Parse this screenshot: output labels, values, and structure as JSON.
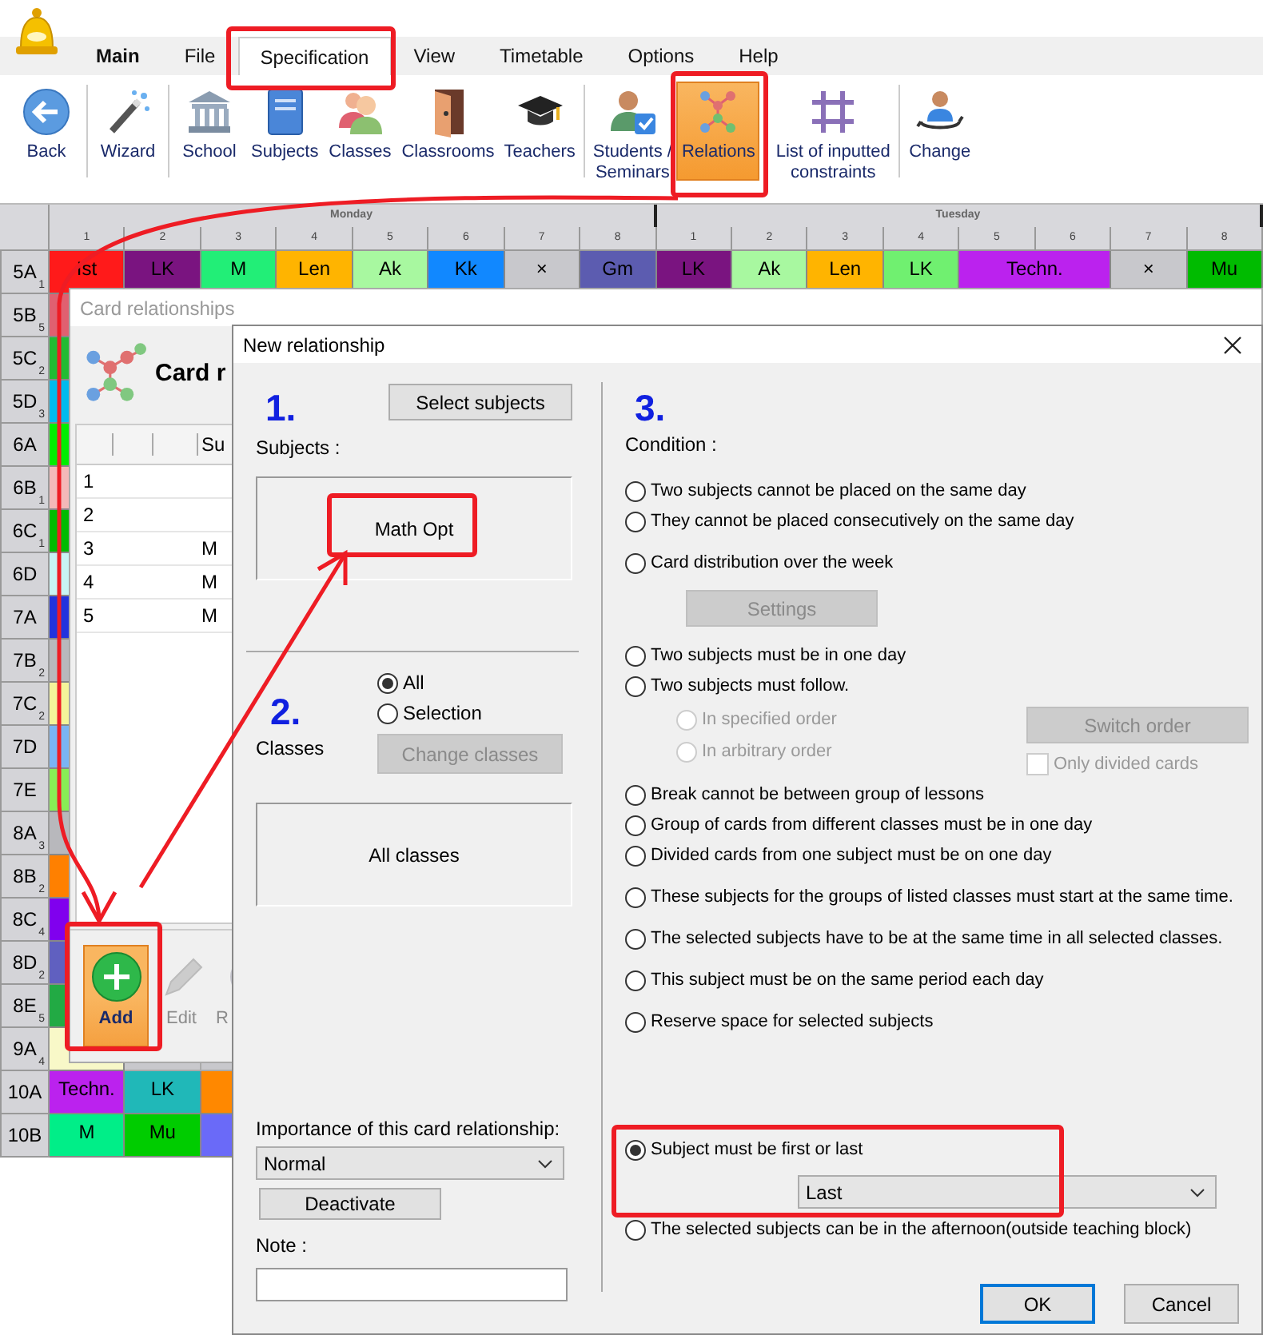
{
  "menu": [
    {
      "label": "Main",
      "kind": "app",
      "selected": false
    },
    {
      "label": "File",
      "kind": "tab",
      "selected": false
    },
    {
      "label": "Specification",
      "kind": "tab",
      "selected": true
    },
    {
      "label": "View",
      "kind": "tab",
      "selected": false
    },
    {
      "label": "Timetable",
      "kind": "tab",
      "selected": false
    },
    {
      "label": "Options",
      "kind": "tab",
      "selected": false
    },
    {
      "label": "Help",
      "kind": "tab",
      "selected": false
    }
  ],
  "toolbar": {
    "groups": [
      [
        {
          "label": "Back",
          "selected": false
        }
      ],
      [
        {
          "label": "Wizard",
          "selected": false
        }
      ],
      [
        {
          "label": "School",
          "selected": false
        },
        {
          "label": "Subjects",
          "selected": false
        },
        {
          "label": "Classes",
          "selected": false
        },
        {
          "label": "Classrooms",
          "selected": false
        },
        {
          "label": "Teachers",
          "selected": false
        }
      ],
      [
        {
          "label": "Students /\nSeminars",
          "selected": false
        },
        {
          "label": "Relations",
          "selected": true
        },
        {
          "label": "List of inputted\nconstraints",
          "selected": false
        }
      ],
      [
        {
          "label": "Change",
          "selected": false
        }
      ]
    ]
  },
  "timetable": {
    "days": [
      {
        "name": "Monday",
        "periods": [
          "1",
          "2",
          "3",
          "4",
          "5",
          "6",
          "7",
          "8"
        ]
      },
      {
        "name": "Tuesday",
        "periods": [
          "1",
          "2",
          "3",
          "4",
          "5",
          "6",
          "7",
          "8"
        ]
      }
    ],
    "rows": [
      {
        "class": "5A",
        "count": "1",
        "cells": [
          {
            "text": "Ist",
            "color": "#ff1a1a",
            "kind": "single"
          },
          {
            "text": "LK",
            "color": "#7a1480",
            "kind": "single"
          },
          {
            "text": "M",
            "color": "#22ee77",
            "kind": "single"
          },
          {
            "text": "Len",
            "color": "#ffb400",
            "kind": "single"
          },
          {
            "text": "Ak",
            "color": "#a8f8a0",
            "kind": "single"
          },
          {
            "text": "Kk",
            "color": "#1188ff",
            "kind": "single"
          },
          {
            "text": "×",
            "color": "#c8c8cc",
            "kind": "single"
          },
          {
            "text": "Gm",
            "color": "#5c5cb0",
            "kind": "single"
          },
          {
            "text": "LK",
            "color": "#7a1480",
            "kind": "single"
          },
          {
            "text": "Ak",
            "color": "#a8f8a0",
            "kind": "single"
          },
          {
            "text": "Len",
            "color": "#ffb400",
            "kind": "single"
          },
          {
            "text": "LK",
            "color": "#70f070",
            "kind": "single"
          },
          {
            "text": "Techn.",
            "color": "#bb22ee",
            "kind": "double"
          },
          {
            "text": "×",
            "color": "#c8c8cc",
            "kind": "single"
          },
          {
            "text": "Mu",
            "color": "#00bb00",
            "kind": "single"
          }
        ]
      },
      {
        "class": "5B",
        "count": "5",
        "cells": [
          {
            "color": "#e06070",
            "kind": "single"
          }
        ]
      },
      {
        "class": "5C",
        "count": "2",
        "cells": [
          {
            "color": "#22bb33",
            "kind": "single"
          }
        ]
      },
      {
        "class": "5D",
        "count": "3",
        "cells": [
          {
            "color": "#00bbee",
            "kind": "single"
          }
        ]
      },
      {
        "class": "6A",
        "cells": [
          {
            "color": "#00ee00",
            "kind": "single"
          }
        ]
      },
      {
        "class": "6B",
        "count": "1",
        "cells": [
          {
            "color": "#f4b8b8",
            "kind": "single"
          }
        ]
      },
      {
        "class": "6C",
        "count": "1",
        "cells": [
          {
            "color": "#00bb00",
            "kind": "single"
          }
        ]
      },
      {
        "class": "6D",
        "cells": [
          {
            "color": "#c8f4f4",
            "kind": "single"
          }
        ]
      },
      {
        "class": "7A",
        "cells": [
          {
            "color": "#2233dd",
            "kind": "single"
          }
        ]
      },
      {
        "class": "7B",
        "count": "2",
        "cells": [
          {
            "color": "#b8b8bc",
            "kind": "single"
          }
        ]
      },
      {
        "class": "7C",
        "count": "2",
        "cells": [
          {
            "color": "#f4f49a",
            "kind": "single"
          }
        ]
      },
      {
        "class": "7D",
        "cells": [
          {
            "color": "#7ab4f4",
            "kind": "single"
          }
        ]
      },
      {
        "class": "7E",
        "cells": [
          {
            "color": "#88ee55",
            "kind": "single"
          }
        ]
      },
      {
        "class": "8A",
        "count": "3",
        "cells": [
          {
            "color": "#b8b8bc",
            "kind": "single"
          }
        ]
      },
      {
        "class": "8B",
        "count": "2",
        "cells": [
          {
            "color": "#ff8000",
            "kind": "single"
          }
        ]
      },
      {
        "class": "8C",
        "count": "4",
        "cells": [
          {
            "color": "#8000ee",
            "kind": "single"
          }
        ]
      },
      {
        "class": "8D",
        "count": "2",
        "cells": [
          {
            "color": "#6060c0",
            "kind": "single"
          }
        ]
      },
      {
        "class": "8E",
        "count": "5",
        "cells": [
          {
            "color": "#22aa44",
            "kind": "single"
          }
        ]
      },
      {
        "class": "9A",
        "count": "4",
        "cells": [
          {
            "color": "#f8f8c8",
            "kind": "single"
          }
        ]
      },
      {
        "class": "10A",
        "cells": [
          {
            "text": "Techn.",
            "color": "#bb22ee",
            "kind": "single"
          },
          {
            "text": "LK",
            "color": "#20b8b8",
            "kind": "single"
          },
          {
            "color": "#ff8800",
            "kind": "single"
          }
        ]
      },
      {
        "class": "10B",
        "cells": [
          {
            "text": "M",
            "color": "#00ee88",
            "kind": "single"
          },
          {
            "text": "Mu",
            "color": "#00cc00",
            "kind": "single"
          },
          {
            "color": "#6a6af8",
            "kind": "single"
          }
        ]
      }
    ]
  },
  "card_relationships": {
    "title": "Card relationships",
    "heading": "Card r",
    "columns": [
      "Su"
    ],
    "rows": [
      {
        "number": "1"
      },
      {
        "number": "2"
      },
      {
        "number": "3",
        "subject": "M"
      },
      {
        "number": "4",
        "subject": "M"
      },
      {
        "number": "5",
        "subject": "M"
      }
    ],
    "actions": [
      {
        "label": "Add",
        "disabled": false,
        "selected": true
      },
      {
        "label": "Edit",
        "disabled": true,
        "selected": false
      },
      {
        "label": "R",
        "disabled": true,
        "selected": false
      }
    ]
  },
  "new_relationship": {
    "title": "New relationship",
    "subjects": {
      "step": "1.",
      "label": "Subjects :",
      "button": "Select subjects",
      "items": [
        "Math Opt"
      ]
    },
    "classes": {
      "step": "2.",
      "label": "Classes",
      "options": [
        {
          "label": "All",
          "selected": true
        },
        {
          "label": "Selection",
          "selected": false
        }
      ],
      "button": {
        "label": "Change classes",
        "disabled": true
      },
      "list_text": "All classes"
    },
    "importance": {
      "label": "Importance of this card relationship:",
      "value": "Normal"
    },
    "deactivate": "Deactivate",
    "note": {
      "label": "Note :"
    },
    "condition": {
      "step": "3.",
      "label": "Condition :",
      "groups": [
        [
          {
            "kind": "radio",
            "label": "Two subjects cannot be placed on the same day",
            "selected": false
          },
          {
            "kind": "radio",
            "label": "They cannot be placed consecutively on the same day",
            "selected": false
          }
        ],
        [
          {
            "kind": "settings",
            "label": "Card distribution over the week",
            "selected": false,
            "button": {
              "label": "Settings",
              "disabled": true
            }
          }
        ],
        [
          {
            "kind": "radio",
            "label": "Two subjects must be in one day",
            "selected": false
          },
          {
            "kind": "follow",
            "label": "Two subjects must follow.",
            "selected": false,
            "suboptions": [
              {
                "label": "In specified order",
                "selected": false,
                "disabled": true
              },
              {
                "label": "In arbitrary order",
                "selected": false,
                "disabled": true
              }
            ],
            "button": {
              "label": "Switch order",
              "disabled": true
            },
            "checkbox": {
              "label": "Only divided cards",
              "checked": false,
              "disabled": true
            }
          },
          {
            "kind": "radio",
            "label": "Break cannot be between group of lessons",
            "selected": false
          },
          {
            "kind": "radio",
            "label": "Group of cards from different classes must be in one day",
            "selected": false
          },
          {
            "kind": "radio",
            "label": "Divided cards from one subject must be on one day",
            "selected": false
          }
        ],
        [
          {
            "kind": "radio",
            "label": "These subjects for the groups of listed classes must start at the same time.",
            "selected": false
          }
        ],
        [
          {
            "kind": "radio",
            "label": "The selected subjects have to be at the same time in all selected classes.",
            "selected": false
          }
        ],
        [
          {
            "kind": "radio",
            "label": "This subject must be on the same period each day",
            "selected": false
          }
        ],
        [
          {
            "kind": "radio",
            "label": "Reserve space for selected subjects",
            "selected": false
          }
        ]
      ],
      "bottom": [
        {
          "kind": "select",
          "label": "Subject must be first or last",
          "selected": true,
          "select": {
            "value": "Last"
          }
        },
        {
          "kind": "radio",
          "label": "The selected subjects can be in the afternoon(outside teaching block)",
          "selected": false
        }
      ]
    },
    "buttons": [
      {
        "label": "OK",
        "default": true
      },
      {
        "label": "Cancel",
        "default": false
      }
    ]
  }
}
